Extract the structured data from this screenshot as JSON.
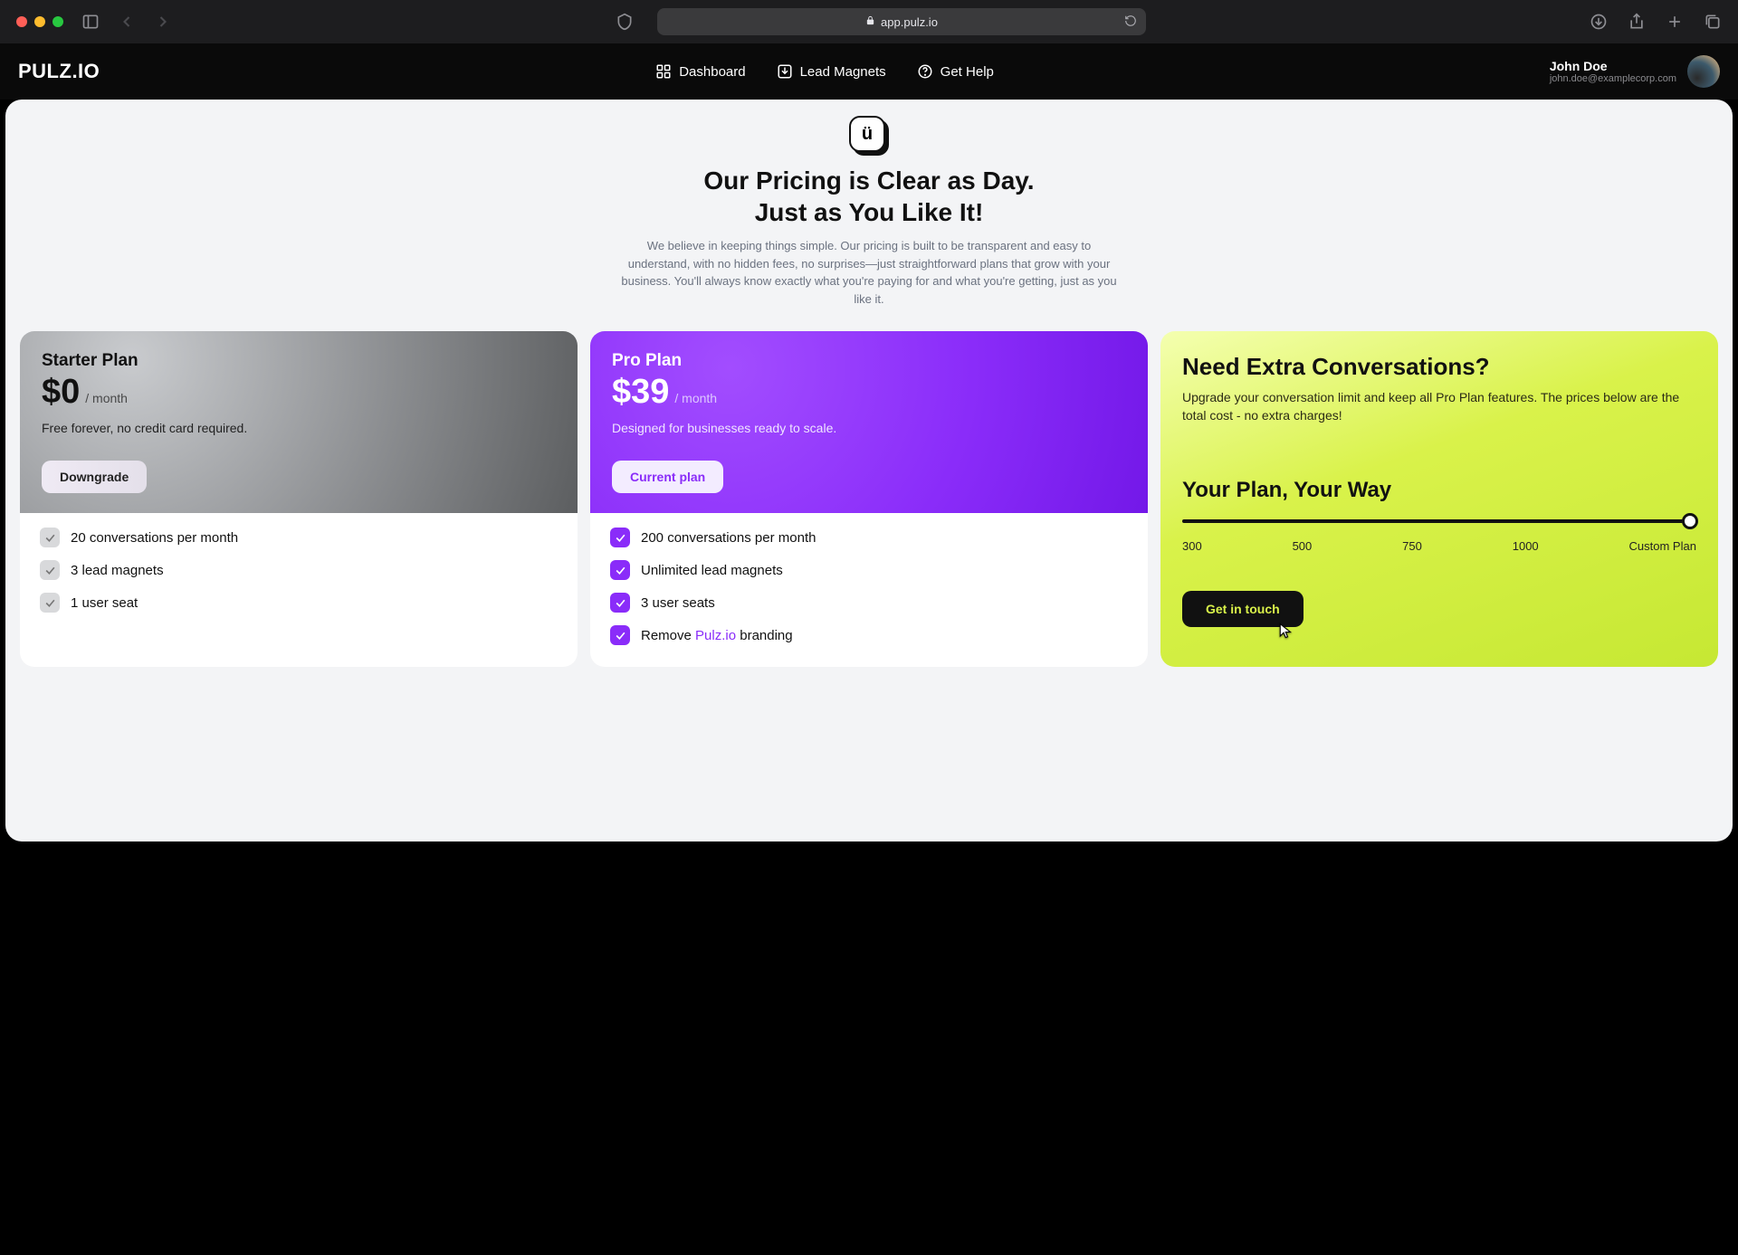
{
  "browser": {
    "url": "app.pulz.io"
  },
  "brand": "PULZ.IO",
  "nav": [
    {
      "label": "Dashboard"
    },
    {
      "label": "Lead Magnets"
    },
    {
      "label": "Get Help"
    }
  ],
  "user": {
    "name": "John Doe",
    "email": "john.doe@examplecorp.com"
  },
  "hero": {
    "title_line1": "Our Pricing is Clear as Day.",
    "title_line2": "Just as You Like It!",
    "subtitle": "We believe in keeping things simple. Our pricing is built to be transparent and easy to understand, with no hidden fees, no surprises—just straightforward plans that grow with your business. You'll always know exactly what you're paying for and what you're getting, just as you like it."
  },
  "plans": {
    "starter": {
      "name": "Starter Plan",
      "price": "$0",
      "per": "/ month",
      "tagline": "Free forever, no credit card required.",
      "button": "Downgrade",
      "features": [
        "20 conversations per month",
        "3 lead magnets",
        "1 user seat"
      ]
    },
    "pro": {
      "name": "Pro Plan",
      "price": "$39",
      "per": "/ month",
      "tagline": "Designed for businesses ready to scale.",
      "button": "Current plan",
      "features": [
        "200 conversations per month",
        "Unlimited lead magnets",
        "3 user seats"
      ],
      "feature_remove_prefix": "Remove ",
      "feature_remove_brand": "Pulz.io",
      "feature_remove_suffix": " branding"
    }
  },
  "extra": {
    "title": "Need Extra Conversations?",
    "subtitle": "Upgrade your conversation limit and keep all Pro Plan features. The prices below are the total cost - no extra charges!",
    "heading": "Your Plan, Your Way",
    "ticks": [
      "300",
      "500",
      "750",
      "1000",
      "Custom Plan"
    ],
    "button": "Get in touch"
  }
}
